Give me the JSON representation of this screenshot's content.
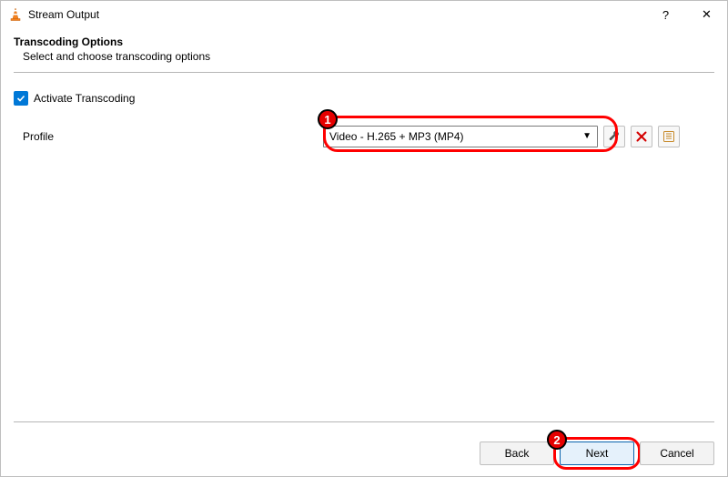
{
  "window": {
    "title": "Stream Output",
    "help_glyph": "?",
    "close_glyph": "✕"
  },
  "section": {
    "heading": "Transcoding Options",
    "subheading": "Select and choose transcoding options"
  },
  "checkbox": {
    "label": "Activate Transcoding",
    "checked": true
  },
  "profile": {
    "label": "Profile",
    "selected": "Video - H.265 + MP3 (MP4)"
  },
  "tool_icons": {
    "wrench": "wrench-icon",
    "delete": "delete-icon",
    "new": "new-profile-icon"
  },
  "footer": {
    "back": "Back",
    "next": "Next",
    "cancel": "Cancel"
  },
  "callouts": {
    "one": "1",
    "two": "2"
  }
}
